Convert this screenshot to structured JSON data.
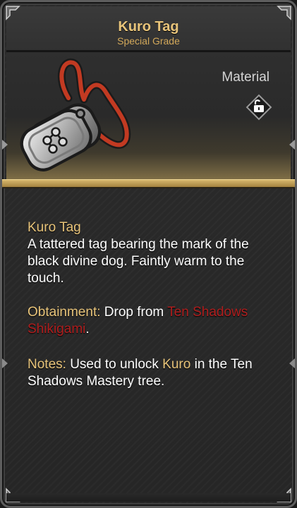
{
  "item": {
    "title": "Kuro Tag",
    "grade": "Special Grade",
    "category": "Material",
    "lock_icon": "unlock-icon"
  },
  "description": {
    "name": "Kuro Tag",
    "flavor": "A tattered tag bearing the mark of the black divine dog. Faintly warm to the touch.",
    "obtainment_label": "Obtainment:",
    "obtainment_prefix": " Drop from ",
    "obtainment_source": "Ten Shadows Shikigami",
    "obtainment_suffix": ".",
    "notes_label": "Notes:",
    "notes_prefix": " Used to unlock ",
    "notes_highlight": "Kuro",
    "notes_suffix": " in the Ten Shadows Mastery tree."
  },
  "colors": {
    "title_gold": "#e8c47a",
    "highlight_gold": "#e8c47a",
    "source_red": "#b01e1e",
    "body_text": "#ffffff"
  }
}
